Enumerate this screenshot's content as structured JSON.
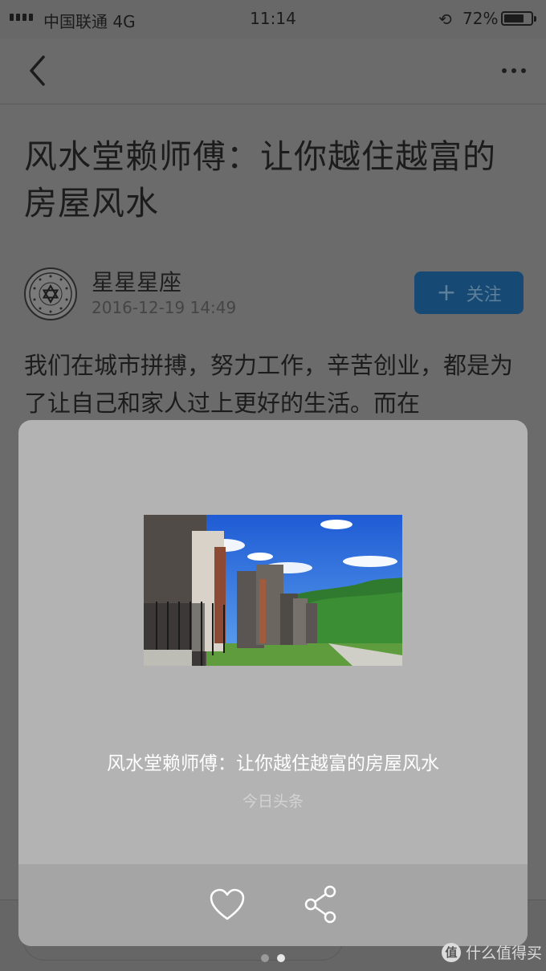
{
  "status_bar": {
    "carrier": "中国联通 4G",
    "time": "11:14",
    "battery": "72%"
  },
  "nav": {
    "back_icon": "chevron-left-icon",
    "more_icon": "more-horizontal-icon"
  },
  "article": {
    "title": "风水堂赖师傅：让你越住越富的房屋风水",
    "author": "星星星座",
    "date": "2016-12-19 14:49",
    "follow_label": "关注",
    "body": "我们在城市拼搏，努力工作，辛苦创业，都是为了让自己和家人过上更好的生活。而在"
  },
  "share_card": {
    "title": "风水堂赖师傅：让你越住越富的房屋风水",
    "source": "今日头条",
    "like_icon": "heart-icon",
    "share_icon": "share-icon"
  },
  "pager": {
    "total": 2,
    "active_index": 1
  },
  "watermark": {
    "text": "什么值得买",
    "logo_char": "值"
  }
}
